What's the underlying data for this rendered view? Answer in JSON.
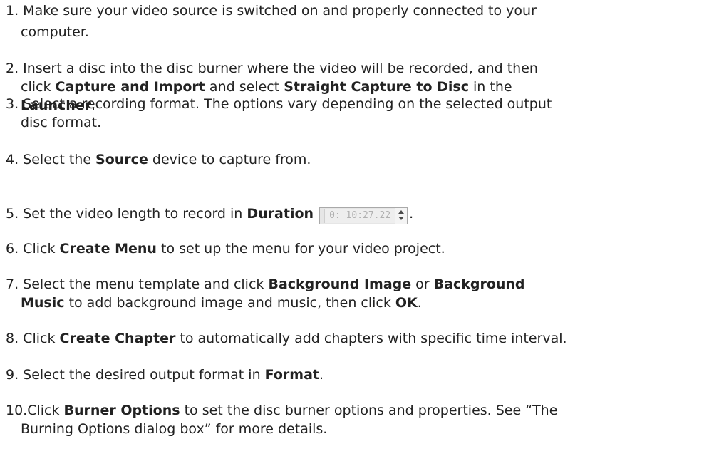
{
  "steps": [
    {
      "num": "1. ",
      "lines": [
        [
          {
            "t": "Make sure your video source is switched on and properly connected to your"
          }
        ],
        [
          {
            "t": "computer."
          }
        ]
      ]
    },
    {
      "num": "2. ",
      "lines": [
        [
          {
            "t": "Insert a disc into the disc burner where the video will be recorded, and then"
          }
        ],
        [
          {
            "t": "click "
          },
          {
            "t": "Capture and Import",
            "b": true
          },
          {
            "t": " and select "
          },
          {
            "t": "Straight Capture to Disc",
            "b": true
          },
          {
            "t": " in the"
          }
        ],
        [
          {
            "t": "Launcher",
            "b": true
          },
          {
            "t": "."
          }
        ]
      ]
    },
    {
      "num": "3. ",
      "lines": [
        [
          {
            "t": "Select a recording format. The options vary depending on the selected output"
          }
        ],
        [
          {
            "t": "disc format."
          }
        ]
      ]
    },
    {
      "num": "4. ",
      "lines": [
        [
          {
            "t": "Select the "
          },
          {
            "t": "Source",
            "b": true
          },
          {
            "t": " device to capture from."
          }
        ]
      ]
    },
    {
      "num": "5. ",
      "lines": [
        [
          {
            "t": "Set the video length to record in "
          },
          {
            "t": "Duration",
            "b": true
          },
          {
            "widget": "timecode"
          },
          {
            "t": "."
          }
        ]
      ]
    },
    {
      "num": "6. ",
      "lines": [
        [
          {
            "t": "Click "
          },
          {
            "t": "Create Menu",
            "b": true
          },
          {
            "t": " to set up the menu for your video project."
          }
        ]
      ]
    },
    {
      "num": "7. ",
      "lines": [
        [
          {
            "t": "Select the menu template and click "
          },
          {
            "t": "Background Image",
            "b": true
          },
          {
            "t": " or "
          },
          {
            "t": "Background",
            "b": true
          }
        ],
        [
          {
            "t": "Music",
            "b": true
          },
          {
            "t": " to add background image and music, then click "
          },
          {
            "t": "OK",
            "b": true
          },
          {
            "t": "."
          }
        ]
      ]
    },
    {
      "num": "8. ",
      "lines": [
        [
          {
            "t": "Click "
          },
          {
            "t": "Create Chapter",
            "b": true
          },
          {
            "t": " to automatically add chapters with specific time interval."
          }
        ]
      ]
    },
    {
      "num": "9. ",
      "lines": [
        [
          {
            "t": "Select the desired output format in "
          },
          {
            "t": "Format",
            "b": true
          },
          {
            "t": "."
          }
        ]
      ]
    },
    {
      "num": "10.",
      "lines": [
        [
          {
            "t": "Click "
          },
          {
            "t": "Burner Options",
            "b": true
          },
          {
            "t": " to set the disc burner options and properties. See “The"
          }
        ],
        [
          {
            "t": "Burning Options dialog box” for more details."
          }
        ]
      ]
    }
  ],
  "duration_widget": {
    "value": "0: 10:27.22",
    "spinner_icon": "up-down-spinner-icon"
  }
}
